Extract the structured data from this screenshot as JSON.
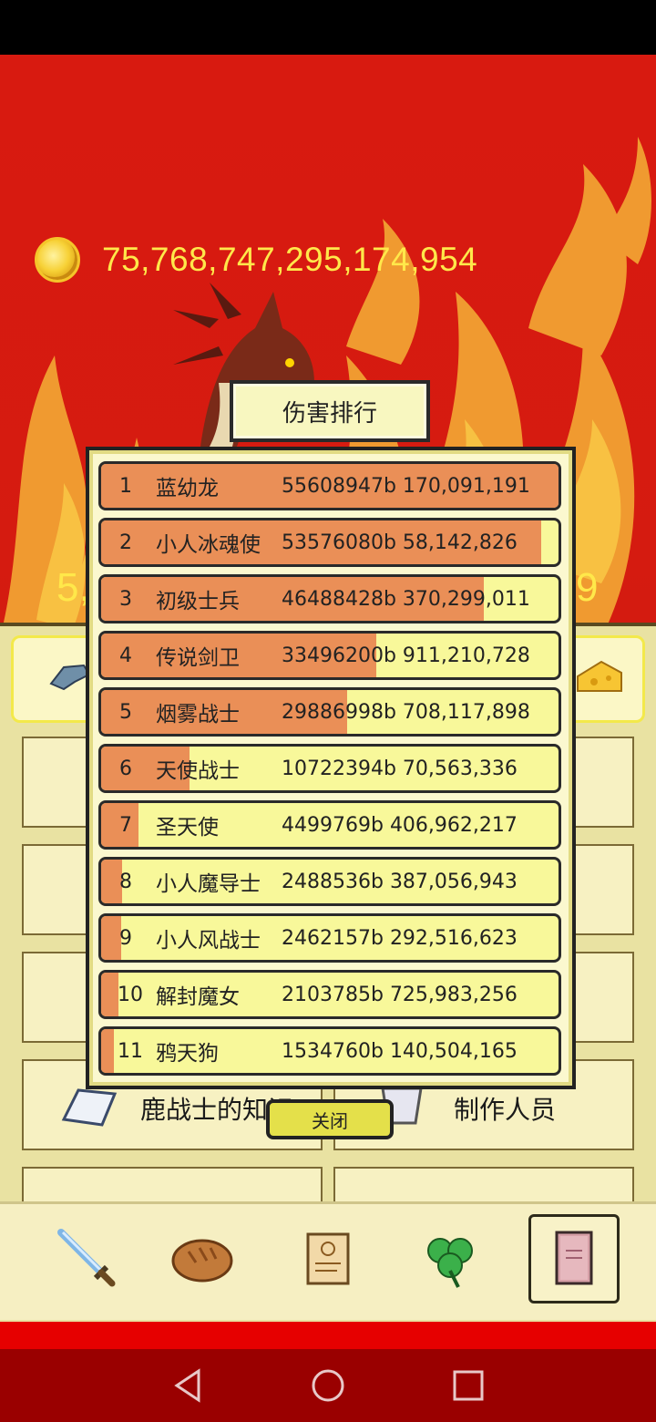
{
  "game": {
    "gold_amount": "75,768,747,295,174,954",
    "side_left": "5,",
    "side_right": "9"
  },
  "menu": {
    "knowledge_label": "鹿战士的知识",
    "credits_label": "制作人员"
  },
  "ranking_dialog": {
    "title": "伤害排行",
    "close_label": "关闭",
    "rows": [
      {
        "rank": "1",
        "name": "蓝幼龙",
        "value": "55608947b 170,091,191",
        "fill": 1.0
      },
      {
        "rank": "2",
        "name": "小人冰魂使",
        "value": "53576080b 58,142,826",
        "fill": 0.963
      },
      {
        "rank": "3",
        "name": "初级士兵",
        "value": "46488428b 370,299,011",
        "fill": 0.836
      },
      {
        "rank": "4",
        "name": "传说剑卫",
        "value": "33496200b 911,210,728",
        "fill": 0.602
      },
      {
        "rank": "5",
        "name": "烟雾战士",
        "value": "29886998b 708,117,898",
        "fill": 0.537
      },
      {
        "rank": "6",
        "name": "天使战士",
        "value": "10722394b 70,563,336",
        "fill": 0.193
      },
      {
        "rank": "7",
        "name": "圣天使",
        "value": "4499769b 406,962,217",
        "fill": 0.081
      },
      {
        "rank": "8",
        "name": "小人魔导士",
        "value": "2488536b 387,056,943",
        "fill": 0.045
      },
      {
        "rank": "9",
        "name": "小人风战士",
        "value": "2462157b 292,516,623",
        "fill": 0.044
      },
      {
        "rank": "10",
        "name": "解封魔女",
        "value": "2103785b 725,983,256",
        "fill": 0.038
      },
      {
        "rank": "11",
        "name": "鸦天狗",
        "value": "1534760b 140,504,165",
        "fill": 0.028
      }
    ]
  },
  "bottom_nav": [
    {
      "icon": "sword-icon"
    },
    {
      "icon": "bread-icon"
    },
    {
      "icon": "scroll-icon"
    },
    {
      "icon": "clover-icon"
    },
    {
      "icon": "book-icon",
      "active": true
    }
  ],
  "colors": {
    "background_red": "#d81a10",
    "gold_text": "#ffe84a",
    "bar_fill": "#ea8f57",
    "bar_empty": "#f8f89a",
    "panel": "#fbf8cf"
  }
}
